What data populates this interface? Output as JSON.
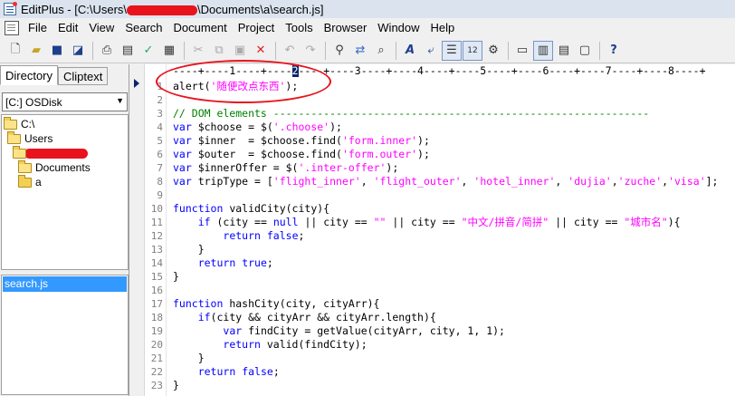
{
  "window": {
    "title_pre": "EditPlus - [C:\\Users\\",
    "title_post": "\\Documents\\a\\search.js]"
  },
  "menu": [
    "File",
    "Edit",
    "View",
    "Search",
    "Document",
    "Project",
    "Tools",
    "Browser",
    "Window",
    "Help"
  ],
  "toolbar_icons": [
    "new-file-icon",
    "open-folder-icon",
    "save-icon",
    "save-all-icon",
    "separator",
    "print-icon",
    "print-preview-icon",
    "spellcheck-icon",
    "separator",
    "cut-icon",
    "copy-icon",
    "paste-icon",
    "delete-icon",
    "separator",
    "undo-icon",
    "redo-icon",
    "separator",
    "find-icon",
    "replace-icon",
    "find-files-icon",
    "separator",
    "font-icon",
    "word-wrap-icon",
    "ruler-toggle-icon",
    "line-number-icon",
    "settings-icon",
    "separator",
    "browser-icon",
    "cliptext-icon",
    "directory-icon",
    "output-icon",
    "separator",
    "help-icon"
  ],
  "left_panel": {
    "tabs": [
      "Directory",
      "Cliptext"
    ],
    "drive": "[C:] OSDisk",
    "tree": [
      "C:\\",
      "Users",
      "",
      "Documents",
      "a"
    ],
    "files": [
      "search.js"
    ]
  },
  "editor": {
    "ruler": "----+----1----+----2----+----3----+----4----+----5----+----6----+----7----+----8----+",
    "ruler_highlight": "2",
    "lines": [
      {
        "n": "1",
        "text": "alert('随便改点东西');"
      },
      {
        "n": "2",
        "text": ""
      },
      {
        "n": "3",
        "text": "// DOM elements ------------------------------------------------------------"
      },
      {
        "n": "4",
        "text": "var $choose = $('.choose');"
      },
      {
        "n": "5",
        "text": "var $inner  = $choose.find('form.inner');"
      },
      {
        "n": "6",
        "text": "var $outer  = $choose.find('form.outer');"
      },
      {
        "n": "7",
        "text": "var $innerOffer = $('.inter-offer');"
      },
      {
        "n": "8",
        "text": "var tripType = ['flight_inner', 'flight_outer', 'hotel_inner', 'dujia','zuche','visa'];"
      },
      {
        "n": "9",
        "text": ""
      },
      {
        "n": "10",
        "text": "function validCity(city){"
      },
      {
        "n": "11",
        "text": "    if (city == null || city == \"\" || city == \"中文/拼音/简拼\" || city == \"城市名\"){"
      },
      {
        "n": "12",
        "text": "        return false;"
      },
      {
        "n": "13",
        "text": "    }"
      },
      {
        "n": "14",
        "text": "    return true;"
      },
      {
        "n": "15",
        "text": "}"
      },
      {
        "n": "16",
        "text": ""
      },
      {
        "n": "17",
        "text": "function hashCity(city, cityArr){"
      },
      {
        "n": "18",
        "text": "    if(city && cityArr && cityArr.length){"
      },
      {
        "n": "19",
        "text": "        var findCity = getValue(cityArr, city, 1, 1);"
      },
      {
        "n": "20",
        "text": "        return valid(findCity);"
      },
      {
        "n": "21",
        "text": "    }"
      },
      {
        "n": "22",
        "text": "    return false;"
      },
      {
        "n": "23",
        "text": "}"
      }
    ]
  },
  "colors": {
    "keyword": "#0000ff",
    "string": "#ff00ff",
    "comment": "#008000",
    "selection": "#3399ff",
    "annotation": "#e8131c"
  }
}
